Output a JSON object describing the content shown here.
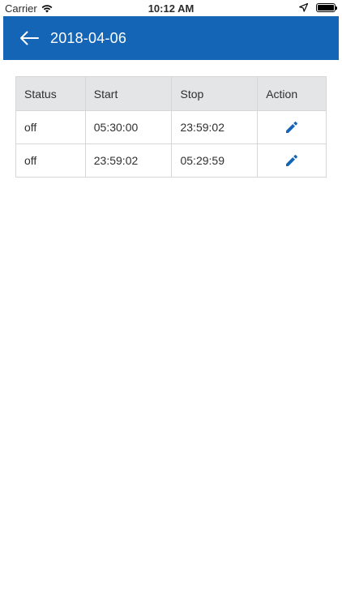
{
  "status_bar": {
    "carrier": "Carrier",
    "time": "10:12 AM"
  },
  "header": {
    "title": "2018-04-06",
    "background_color": "#1565b6"
  },
  "table": {
    "columns": [
      "Status",
      "Start",
      "Stop",
      "Action"
    ],
    "rows": [
      {
        "status": "off",
        "start": "05:30:00",
        "stop": "23:59:02",
        "action_icon": "pencil-icon"
      },
      {
        "status": "off",
        "start": "23:59:02",
        "stop": "05:29:59",
        "action_icon": "pencil-icon"
      }
    ],
    "edit_icon_color": "#1565b6"
  }
}
